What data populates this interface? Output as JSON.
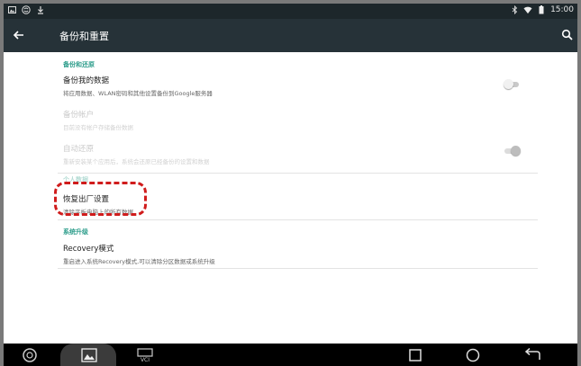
{
  "status_bar": {
    "time": "15:00",
    "icons": [
      "image-notification-icon",
      "app-notification-icon",
      "download-icon",
      "bluetooth-icon",
      "wifi-icon",
      "battery-icon"
    ]
  },
  "app_bar": {
    "title": "备份和重置",
    "icons": [
      "back-arrow-icon",
      "search-icon"
    ]
  },
  "sections": {
    "backup": {
      "header": "备份和还原",
      "items": [
        {
          "title": "备份我的数据",
          "subtitle": "将应用数据、WLAN密码和其他设置备份到Google服务器",
          "toggle": "off",
          "enabled": true
        },
        {
          "title": "备份帐户",
          "subtitle": "目前没有帐户存储备份数据",
          "enabled": false
        },
        {
          "title": "自动还原",
          "subtitle": "重新安装某个应用后，系统会还原已经备份的设置和数据",
          "toggle": "on",
          "enabled": false
        }
      ]
    },
    "personal": {
      "header": "个人数据",
      "items": [
        {
          "title": "恢复出厂设置",
          "subtitle": "清除平板电脑上的所有数据"
        }
      ]
    },
    "system": {
      "header": "系统升级",
      "items": [
        {
          "title": "Recovery模式",
          "subtitle": "重启进入系统Recovery模式,可以清除分区数据或系统升级"
        }
      ]
    }
  },
  "nav_bar": {
    "icons": [
      "browser-icon",
      "gallery-icon",
      "vci-icon",
      "recent-apps-icon",
      "home-icon",
      "back-icon"
    ],
    "vci_label": "VCI"
  },
  "colors": {
    "app_bar": "#263238",
    "status_bar": "#1d272b",
    "section_header": "#2b9c8a",
    "highlight": "#d01c1c"
  }
}
